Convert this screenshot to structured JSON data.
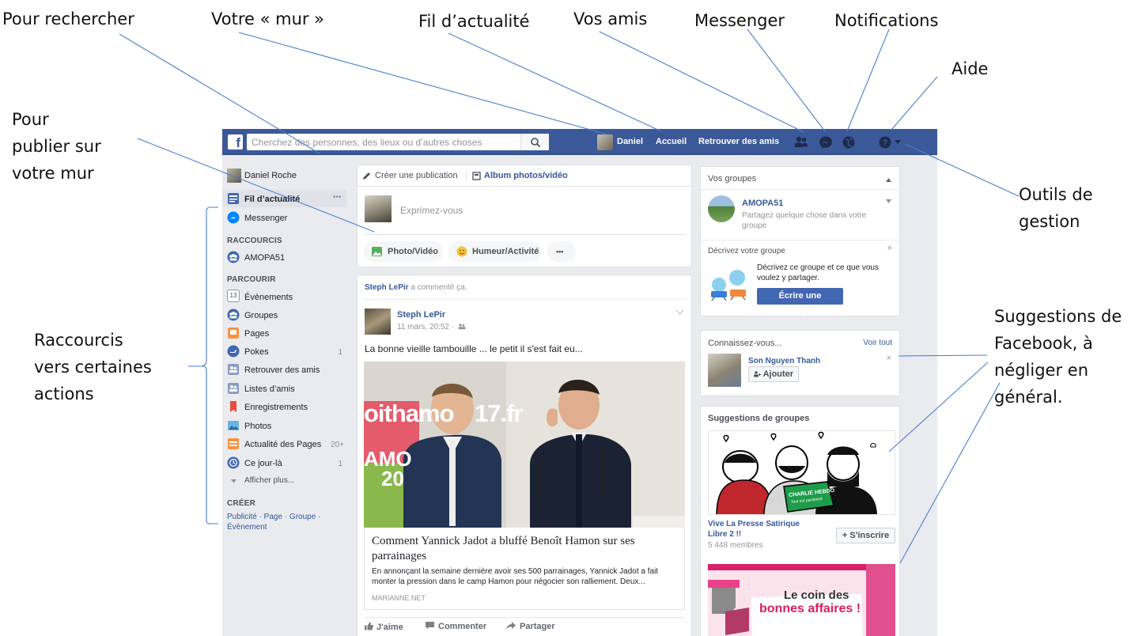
{
  "annotations": {
    "search": "Pour rechercher",
    "wall": "Votre « mur »",
    "feed": "Fil d’actualité",
    "friends": "Vos amis",
    "messenger": "Messenger",
    "notifications": "Notifications",
    "help": "Aide",
    "publish_l1": "Pour",
    "publish_l2": "publier sur",
    "publish_l3": "votre mur",
    "shortcuts_l1": "Raccourcis",
    "shortcuts_l2": "vers certaines",
    "shortcuts_l3": "actions",
    "tools_l1": "Outils de",
    "tools_l2": "gestion",
    "suggest_l1": "Suggestions de",
    "suggest_l2": "Facebook, à",
    "suggest_l3": "négliger en",
    "suggest_l4": "général."
  },
  "topbar": {
    "logo": "f",
    "search_placeholder": "Cherchez des personnes, des lieux ou d’autres choses",
    "profile_name": "Daniel",
    "home": "Accueil",
    "find_friends": "Retrouver des amis",
    "color": "#3b5998"
  },
  "left": {
    "profile": "Daniel Roche",
    "newsfeed": "Fil d’actualité",
    "newsfeed_more": "•••",
    "messenger": "Messenger",
    "shortcuts_title": "RACCOURCIS",
    "shortcut_group": "AMOPA51",
    "explore_title": "PARCOURIR",
    "explore": [
      {
        "label": "Évènements",
        "count": "",
        "icon": "calendar-icon"
      },
      {
        "label": "Groupes",
        "count": "",
        "icon": "groups-icon"
      },
      {
        "label": "Pages",
        "count": "",
        "icon": "flag-icon"
      },
      {
        "label": "Pokes",
        "count": "1",
        "icon": "poke-icon"
      },
      {
        "label": "Retrouver des amis",
        "count": "",
        "icon": "friends-icon"
      },
      {
        "label": "Listes d’amis",
        "count": "",
        "icon": "friends-list-icon"
      },
      {
        "label": "Enregistrements",
        "count": "",
        "icon": "bookmark-icon"
      },
      {
        "label": "Photos",
        "count": "",
        "icon": "photos-icon"
      },
      {
        "label": "Actualité des Pages",
        "count": "20+",
        "icon": "pages-feed-icon"
      },
      {
        "label": "Ce jour-là",
        "count": "1",
        "icon": "memories-icon"
      }
    ],
    "calendar_num": "13",
    "see_more": "Afficher plus...",
    "create_title": "CRÉER",
    "create_links": "Publicité · Page · Groupe ·",
    "create_links2": "Évènement"
  },
  "composer": {
    "create_post": "Créer une publication",
    "album": "Album photos/vidéo",
    "placeholder": "Exprimez-vous",
    "photo_video": "Photo/Vidéo",
    "feeling": "Humeur/Activité",
    "more": "•••"
  },
  "post": {
    "activity_name": "Steph LePir",
    "activity_text": " a commenté ça.",
    "author": "Steph LePir",
    "date": "11 mars, 20:52 ·",
    "text": "La bonne vieille tambouille ... le petit il s'est fait eu...",
    "image_banner": "oithamo",
    "image_banner2": "17.fr",
    "image_banner3": "AMO",
    "image_banner4": "20",
    "link_title": "Comment Yannick Jadot a bluffé Benoît Hamon sur ses parrainages",
    "link_desc": "En annonçant la semaine dernière avoir ses 500 parrainages, Yannick Jadot a fait monter la pression dans le camp Hamon pour négocier son ralliement. Deux...",
    "link_source": "MARIANNE.NET",
    "like": "J'aime",
    "comment": "Commenter",
    "share": "Partager"
  },
  "right": {
    "groups_title": "Vos groupes",
    "group_name": "AMOPA51",
    "group_sub": "Partagez quelque chose dans votre groupe",
    "describe_title": "Décrivez votre groupe",
    "describe_text": "Décrivez ce groupe et ce que vous voulez y partager.",
    "describe_btn": "Écrire une description",
    "pymk_title": "Connaissez-vous...",
    "pymk_all": "Voir tout",
    "pymk_name": "Son Nguyen Thanh",
    "pymk_add": "Ajouter",
    "sugg_title": "Suggestions de groupes",
    "sugg_badge": "CHARLIE HEBDO",
    "sugg_badge2": "Tout est pardonné",
    "sugg_group": "Vive La Presse Satirique Libre 2 !!",
    "sugg_members": "5 448 membres",
    "sugg_join": "+ S'inscrire",
    "ad_text_l1": "Le coin des",
    "ad_text_l2": "bonnes affaires !"
  }
}
